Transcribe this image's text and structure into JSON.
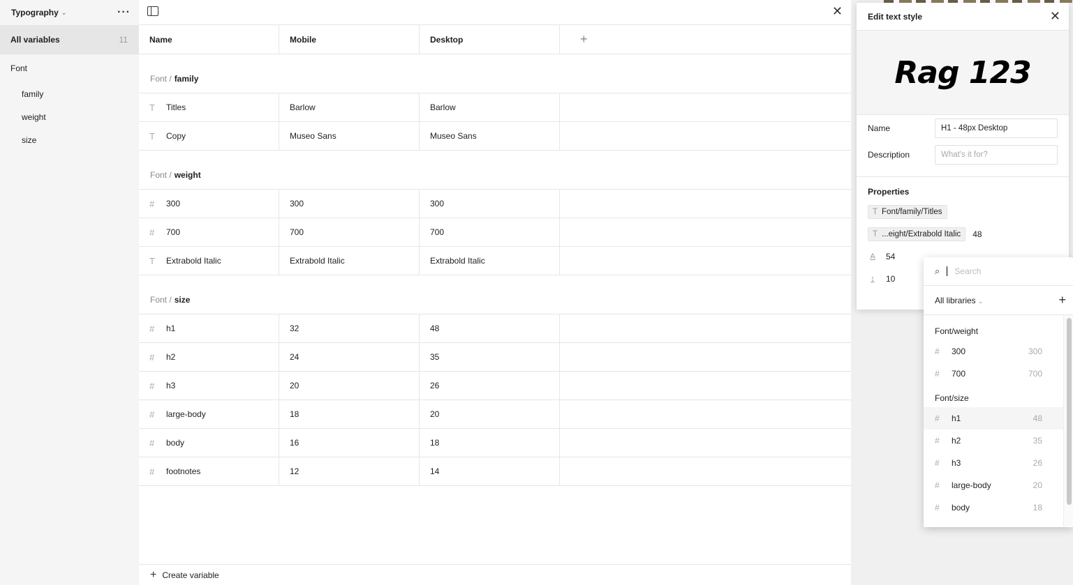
{
  "sidebar": {
    "collection_title": "Typography",
    "all_variables_label": "All variables",
    "all_variables_count": "11",
    "group_label": "Font",
    "subgroups": [
      "family",
      "weight",
      "size"
    ]
  },
  "table": {
    "columns": [
      "Name",
      "Mobile",
      "Desktop"
    ],
    "groups": [
      {
        "prefix": "Font /",
        "name": "family",
        "rows": [
          {
            "icon": "text-type-icon",
            "name": "Titles",
            "mobile": "Barlow",
            "desktop": "Barlow"
          },
          {
            "icon": "text-type-icon",
            "name": "Copy",
            "mobile": "Museo Sans",
            "desktop": "Museo Sans"
          }
        ]
      },
      {
        "prefix": "Font /",
        "name": "weight",
        "rows": [
          {
            "icon": "number-type-icon",
            "name": "300",
            "mobile": "300",
            "desktop": "300"
          },
          {
            "icon": "number-type-icon",
            "name": "700",
            "mobile": "700",
            "desktop": "700"
          },
          {
            "icon": "text-type-icon",
            "name": "Extrabold Italic",
            "mobile": "Extrabold Italic",
            "desktop": "Extrabold Italic"
          }
        ]
      },
      {
        "prefix": "Font /",
        "name": "size",
        "rows": [
          {
            "icon": "number-type-icon",
            "name": "h1",
            "mobile": "32",
            "desktop": "48"
          },
          {
            "icon": "number-type-icon",
            "name": "h2",
            "mobile": "24",
            "desktop": "35"
          },
          {
            "icon": "number-type-icon",
            "name": "h3",
            "mobile": "20",
            "desktop": "26"
          },
          {
            "icon": "number-type-icon",
            "name": "large-body",
            "mobile": "18",
            "desktop": "20"
          },
          {
            "icon": "number-type-icon",
            "name": "body",
            "mobile": "16",
            "desktop": "18"
          },
          {
            "icon": "number-type-icon",
            "name": "footnotes",
            "mobile": "12",
            "desktop": "14"
          }
        ]
      }
    ],
    "create_variable_label": "Create variable"
  },
  "edit_panel": {
    "title": "Edit text style",
    "preview_text": "Rag 123",
    "name_label": "Name",
    "name_value": "H1 - 48px Desktop",
    "description_label": "Description",
    "description_placeholder": "What's it for?",
    "properties_label": "Properties",
    "font_family_chip": "Font/family/Titles",
    "font_weight_chip": "...eight/Extrabold Italic",
    "font_size_value": "48",
    "line_height_value": "54",
    "letter_spacing_value": "10"
  },
  "dropdown": {
    "search_placeholder": "Search",
    "library_filter": "All libraries",
    "sections": [
      {
        "label": "Font/weight",
        "items": [
          {
            "name": "300",
            "value": "300"
          },
          {
            "name": "700",
            "value": "700"
          }
        ]
      },
      {
        "label": "Font/size",
        "items": [
          {
            "name": "h1",
            "value": "48",
            "highlighted": true
          },
          {
            "name": "h2",
            "value": "35"
          },
          {
            "name": "h3",
            "value": "26"
          },
          {
            "name": "large-body",
            "value": "20"
          },
          {
            "name": "body",
            "value": "18"
          }
        ]
      }
    ]
  }
}
